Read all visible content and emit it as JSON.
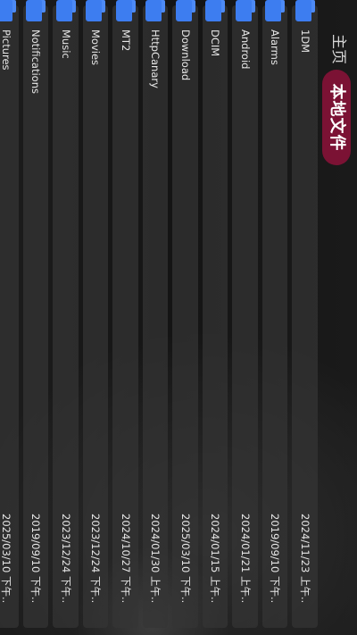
{
  "nav": {
    "home": "主页",
    "local": "本地文件"
  },
  "files": [
    {
      "name": "1DM",
      "date": "2024/11/23 上午..",
      "icon": "folder-icon"
    },
    {
      "name": "Alarms",
      "date": "2019/09/10 下午..",
      "icon": "folder-icon"
    },
    {
      "name": "Android",
      "date": "2024/01/21 上午..",
      "icon": "folder-icon"
    },
    {
      "name": "DCIM",
      "date": "2024/01/15 上午..",
      "icon": "folder-icon"
    },
    {
      "name": "Download",
      "date": "2025/03/10 下午..",
      "icon": "folder-icon"
    },
    {
      "name": "HttpCanary",
      "date": "2024/01/30 上午..",
      "icon": "folder-icon"
    },
    {
      "name": "MT2",
      "date": "2024/10/27 下午..",
      "icon": "folder-icon"
    },
    {
      "name": "Movies",
      "date": "2023/12/24 下午..",
      "icon": "folder-icon"
    },
    {
      "name": "Music",
      "date": "2023/12/24 下午..",
      "icon": "folder-icon"
    },
    {
      "name": "Notifications",
      "date": "2019/09/10 下午..",
      "icon": "folder-icon"
    },
    {
      "name": "Pictures",
      "date": "2025/03/10 下午..",
      "icon": "folder-icon"
    }
  ],
  "colors": {
    "accent": "#7b1234",
    "folder": "#3d7df0",
    "background": "#161616"
  }
}
